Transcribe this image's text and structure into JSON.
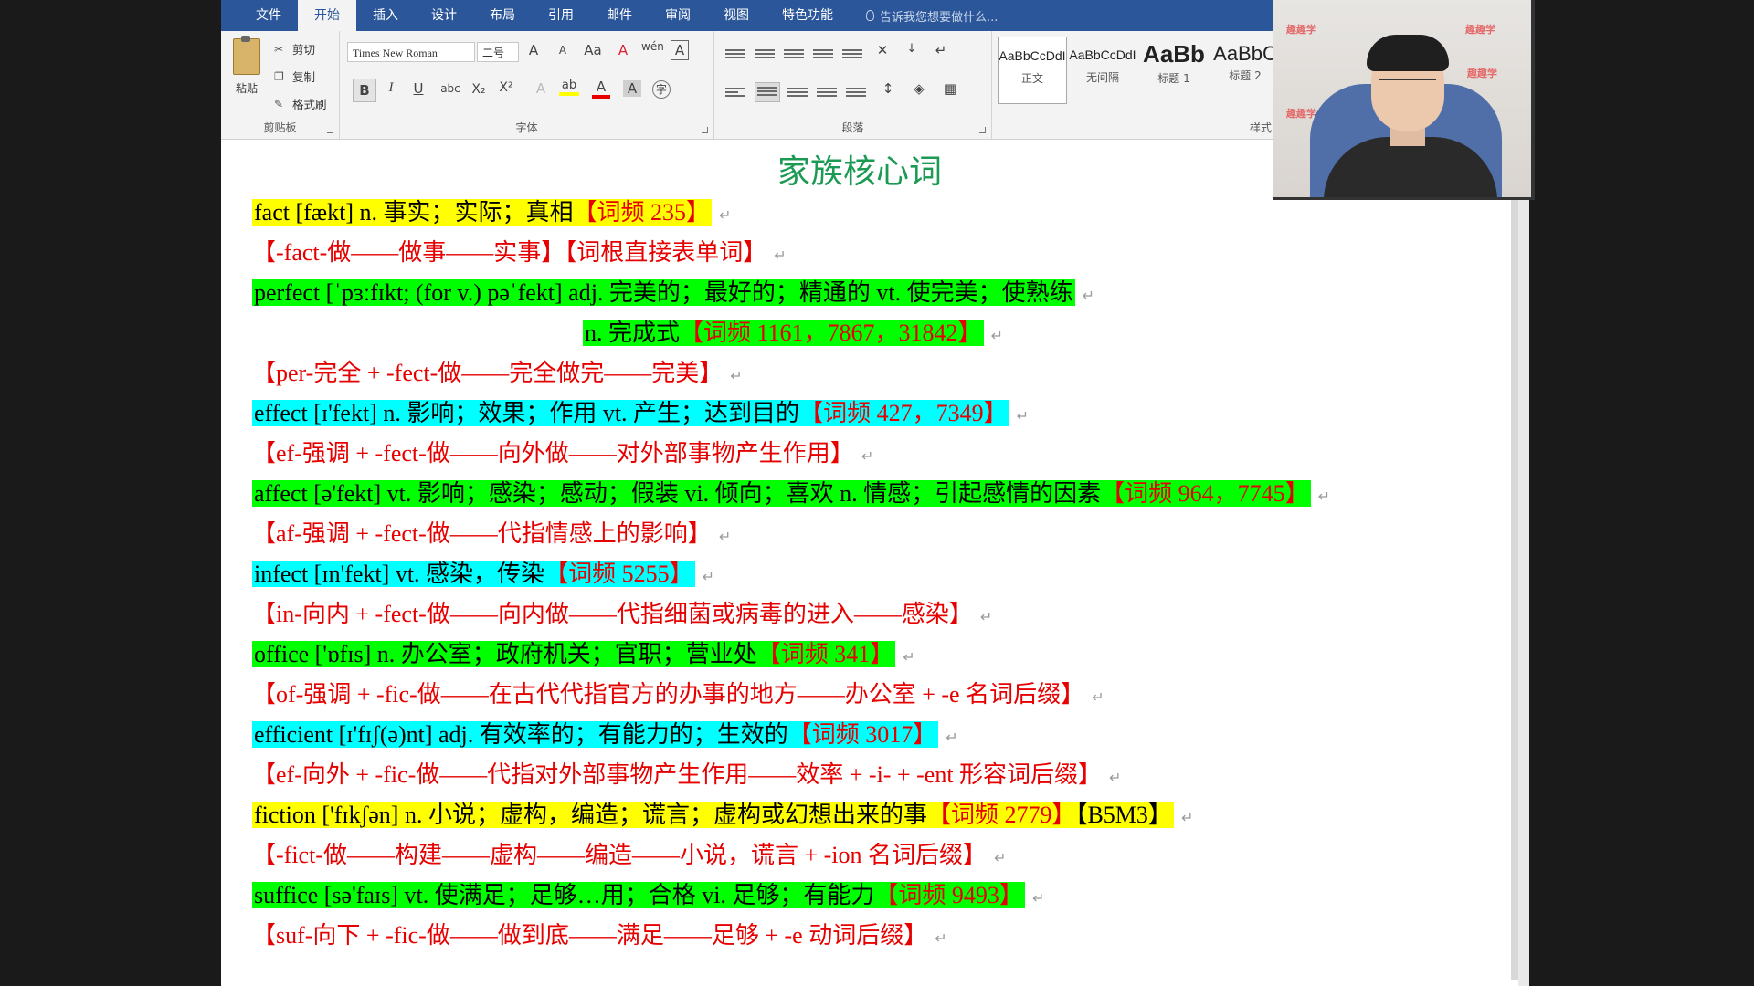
{
  "tabs": [
    "文件",
    "开始",
    "插入",
    "设计",
    "布局",
    "引用",
    "邮件",
    "审阅",
    "视图",
    "特色功能"
  ],
  "active_tab_index": 1,
  "tell_me": "告诉我您想要做什么...",
  "clipboard": {
    "paste": "粘贴",
    "cut": "剪切",
    "copy": "复制",
    "format_painter": "格式刷",
    "group_label": "剪贴板"
  },
  "font": {
    "name": "Times New Roman",
    "size": "二号",
    "grow": "A",
    "shrink": "A",
    "change_case": "Aa",
    "bold": "B",
    "italic": "I",
    "underline": "U",
    "strike": "abc",
    "subscript": "X₂",
    "superscript": "X²",
    "highlight": "ab",
    "font_color": "A",
    "char_shading": "A",
    "enclose": "字",
    "group_label": "字体"
  },
  "paragraph": {
    "group_label": "段落"
  },
  "styles": {
    "items": [
      {
        "sample": "AaBbCcDdI",
        "name": "正文"
      },
      {
        "sample": "AaBbCcDdI",
        "name": "无间隔"
      },
      {
        "sample": "AaBb",
        "name": "标题 1"
      },
      {
        "sample": "AaBbC",
        "name": "标题 2"
      }
    ],
    "group_label": "样式"
  },
  "document": {
    "title": "家族核心词",
    "lines": [
      {
        "text": "fact [fækt] n. 事实；实际；真相",
        "freq": "【词频 235】",
        "highlight": "yellow"
      },
      {
        "text": "",
        "freq": "【-fact-做——做事——实事】【词根直接表单词】",
        "highlight": "none"
      },
      {
        "text": "perfect [ˈpɜːfɪkt; (for v.) pəˈfekt] adj. 完美的；最好的；精通的 vt. 使完美；使熟练",
        "freq": "",
        "highlight": "green"
      },
      {
        "text": "n. 完成式",
        "freq": "【词频 1161，7867，31842】",
        "highlight": "green"
      },
      {
        "text": "",
        "freq": "【per-完全 + -fect-做——完全做完——完美】",
        "highlight": "none"
      },
      {
        "text": "effect [ɪ'fekt] n. 影响；效果；作用 vt. 产生；达到目的",
        "freq": "【词频 427，7349】",
        "highlight": "cyan"
      },
      {
        "text": "",
        "freq": "【ef-强调 + -fect-做——向外做——对外部事物产生作用】",
        "highlight": "none"
      },
      {
        "text": "affect [ə'fekt] vt. 影响；感染；感动；假装 vi. 倾向；喜欢 n. 情感；引起感情的因素",
        "freq": "【词频 964，7745】",
        "highlight": "green"
      },
      {
        "text": "",
        "freq": "【af-强调 + -fect-做——代指情感上的影响】",
        "highlight": "none"
      },
      {
        "text": "infect [ɪn'fekt] vt. 感染，传染",
        "freq": "【词频 5255】",
        "highlight": "cyan"
      },
      {
        "text": "",
        "freq": "【in-向内 + -fect-做——向内做——代指细菌或病毒的进入——感染】",
        "highlight": "none"
      },
      {
        "text": "office ['ɒfɪs] n. 办公室；政府机关；官职；营业处",
        "freq": "【词频 341】",
        "highlight": "green"
      },
      {
        "text": "",
        "freq": "【of-强调 + -fic-做——在古代代指官方的办事的地方——办公室 + -e 名词后缀】",
        "highlight": "none"
      },
      {
        "text": "efficient [ɪ'fɪʃ(ə)nt] adj. 有效率的；有能力的；生效的",
        "freq": "【词频 3017】",
        "highlight": "cyan"
      },
      {
        "text": "",
        "freq": "【ef-向外 + -fic-做——代指对外部事物产生作用——效率 + -i- + -ent 形容词后缀】",
        "highlight": "none"
      },
      {
        "text": "fiction ['fɪkʃən] n. 小说；虚构，编造；谎言；虚构或幻想出来的事",
        "freq": "【词频 2779】",
        "tail": "【B5M3】",
        "highlight": "yellow"
      },
      {
        "text": "",
        "freq": "【-fict-做——构建——虚构——编造——小说，谎言 + -ion 名词后缀】",
        "highlight": "none"
      },
      {
        "text": "suffice [sə'faɪs] vt. 使满足；足够…用；合格 vi. 足够；有能力",
        "freq": "【词频 9493】",
        "highlight": "green"
      },
      {
        "text": "",
        "freq": "【suf-向下 + -fic-做——做到底——满足——足够 + -e 动词后缀】",
        "highlight": "none"
      }
    ]
  },
  "webcam": {
    "logo": "趣趣学"
  },
  "colors": {
    "title_bar": "#2b579a",
    "yellow": "#ffff00",
    "green": "#00ff00",
    "cyan": "#00ffff",
    "red_text": "#e60000",
    "title_green": "#1a9a52"
  }
}
